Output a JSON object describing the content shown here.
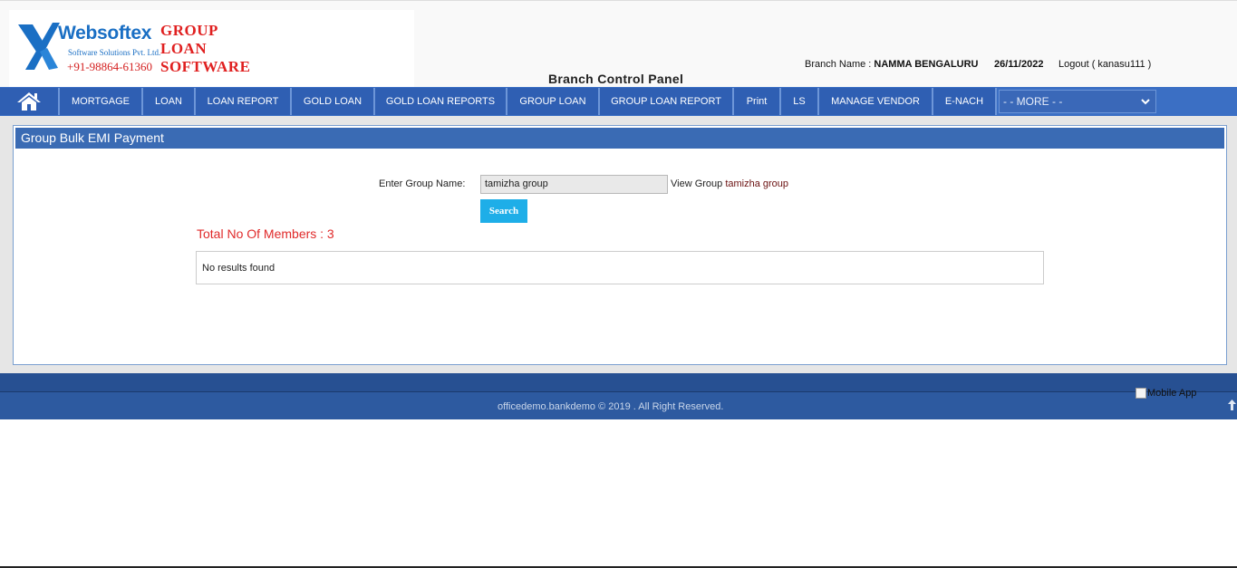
{
  "logo": {
    "brand": "Websoftex",
    "tagline": "Software Solutions Pvt. Ltd.",
    "phone": "+91-98864-61360",
    "product_line1": "GROUP",
    "product_line2": "LOAN",
    "product_line3": "SOFTWARE"
  },
  "header": {
    "panel_title": "Branch Control Panel",
    "branch_label": "Branch Name : ",
    "branch_name": "NAMMA BENGALURU",
    "date": "26/11/2022",
    "logout": "Logout ( kanasu111 )"
  },
  "nav": {
    "home_icon": "home-icon",
    "items": [
      "MORTGAGE",
      "LOAN",
      "LOAN REPORT",
      "GOLD LOAN",
      "GOLD LOAN REPORTS",
      "GROUP LOAN",
      "GROUP LOAN REPORT",
      "Print",
      "LS",
      "MANAGE VENDOR",
      "E-NACH"
    ],
    "more_label": "- - MORE - -"
  },
  "page": {
    "title": "Group Bulk EMI Payment",
    "group_label": "Enter Group Name:",
    "group_value": "tamizha group",
    "view_group_label": "View Group ",
    "view_group_name": "tamizha group",
    "search_label": "Search",
    "members_text": "Total No Of Members : 3",
    "results_text": "No results found"
  },
  "footer": {
    "copyright": "officedemo.bankdemo © 2019 . All Right Reserved.",
    "mobile_app_alt": "Mobile App"
  },
  "colors": {
    "nav_bg": "#3b6fc4",
    "panel_head": "#3a6bb4",
    "search_btn": "#1eaee8",
    "members_text": "#e02a2a",
    "footer_bg": "#2d5aa0"
  }
}
